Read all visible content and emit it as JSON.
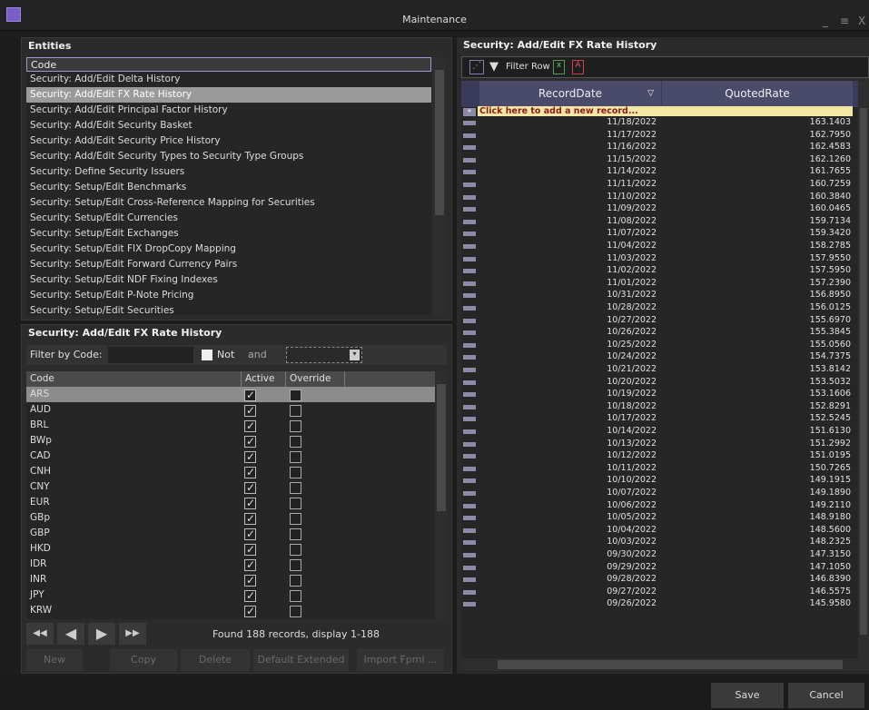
{
  "window": {
    "title": "Maintenance"
  },
  "entities": {
    "title": "Entities",
    "header": "Code",
    "items": [
      "Security: Add/Edit Delta History",
      "Security: Add/Edit FX Rate History",
      "Security: Add/Edit Principal Factor History",
      "Security: Add/Edit Security Basket",
      "Security: Add/Edit Security Price History",
      "Security: Add/Edit Security Types to Security Type Groups",
      "Security: Define Security Issuers",
      "Security: Setup/Edit Benchmarks",
      "Security: Setup/Edit Cross-Reference Mapping for Securities",
      "Security: Setup/Edit Currencies",
      "Security: Setup/Edit Exchanges",
      "Security: Setup/Edit FIX DropCopy Mapping",
      "Security: Setup/Edit Forward Currency Pairs",
      "Security: Setup/Edit NDF Fixing Indexes",
      "Security: Setup/Edit P-Note Pricing",
      "Security: Setup/Edit Securities"
    ]
  },
  "detail": {
    "title": "Security: Add/Edit FX Rate History",
    "filter_label": "Filter by Code:",
    "not_label": "Not",
    "and_label": "and",
    "columns": {
      "code": "Code",
      "active": "Active",
      "override": "Override"
    },
    "codes": [
      "ARS",
      "AUD",
      "BRL",
      "BWp",
      "CAD",
      "CNH",
      "CNY",
      "EUR",
      "GBp",
      "GBP",
      "HKD",
      "IDR",
      "INR",
      "JPY",
      "KRW"
    ],
    "found_text": "Found 188 records, display 1-188",
    "buttons": {
      "new": "New",
      "copy": "Copy",
      "delete": "Delete",
      "default_extended": "Default Extended",
      "import": "Import Fpml ..."
    }
  },
  "grid": {
    "title": "Security: Add/Edit FX Rate History",
    "filter_row": "Filter Row",
    "col_date": "RecordDate",
    "col_rate": "QuotedRate",
    "add_row": "Click here to add a new record...",
    "rows": [
      [
        "11/18/2022",
        "163.1403"
      ],
      [
        "11/17/2022",
        "162.7950"
      ],
      [
        "11/16/2022",
        "162.4583"
      ],
      [
        "11/15/2022",
        "162.1260"
      ],
      [
        "11/14/2022",
        "161.7655"
      ],
      [
        "11/11/2022",
        "160.7259"
      ],
      [
        "11/10/2022",
        "160.3840"
      ],
      [
        "11/09/2022",
        "160.0465"
      ],
      [
        "11/08/2022",
        "159.7134"
      ],
      [
        "11/07/2022",
        "159.3420"
      ],
      [
        "11/04/2022",
        "158.2785"
      ],
      [
        "11/03/2022",
        "157.9550"
      ],
      [
        "11/02/2022",
        "157.5950"
      ],
      [
        "11/01/2022",
        "157.2390"
      ],
      [
        "10/31/2022",
        "156.8950"
      ],
      [
        "10/28/2022",
        "156.0125"
      ],
      [
        "10/27/2022",
        "155.6970"
      ],
      [
        "10/26/2022",
        "155.3845"
      ],
      [
        "10/25/2022",
        "155.0560"
      ],
      [
        "10/24/2022",
        "154.7375"
      ],
      [
        "10/21/2022",
        "153.8142"
      ],
      [
        "10/20/2022",
        "153.5032"
      ],
      [
        "10/19/2022",
        "153.1606"
      ],
      [
        "10/18/2022",
        "152.8291"
      ],
      [
        "10/17/2022",
        "152.5245"
      ],
      [
        "10/14/2022",
        "151.6130"
      ],
      [
        "10/13/2022",
        "151.2992"
      ],
      [
        "10/12/2022",
        "151.0195"
      ],
      [
        "10/11/2022",
        "150.7265"
      ],
      [
        "10/10/2022",
        "149.1915"
      ],
      [
        "10/07/2022",
        "149.1890"
      ],
      [
        "10/06/2022",
        "149.2110"
      ],
      [
        "10/05/2022",
        "148.9180"
      ],
      [
        "10/04/2022",
        "148.5600"
      ],
      [
        "10/03/2022",
        "148.2325"
      ],
      [
        "09/30/2022",
        "147.3150"
      ],
      [
        "09/29/2022",
        "147.1050"
      ],
      [
        "09/28/2022",
        "146.8390"
      ],
      [
        "09/27/2022",
        "146.5575"
      ],
      [
        "09/26/2022",
        "145.9580"
      ]
    ]
  },
  "footer": {
    "save": "Save",
    "cancel": "Cancel"
  },
  "colors": {
    "accent": "#7b5cc9",
    "selected_row": "#9a9a9a",
    "add_row_bg": "#f4e7a6"
  }
}
